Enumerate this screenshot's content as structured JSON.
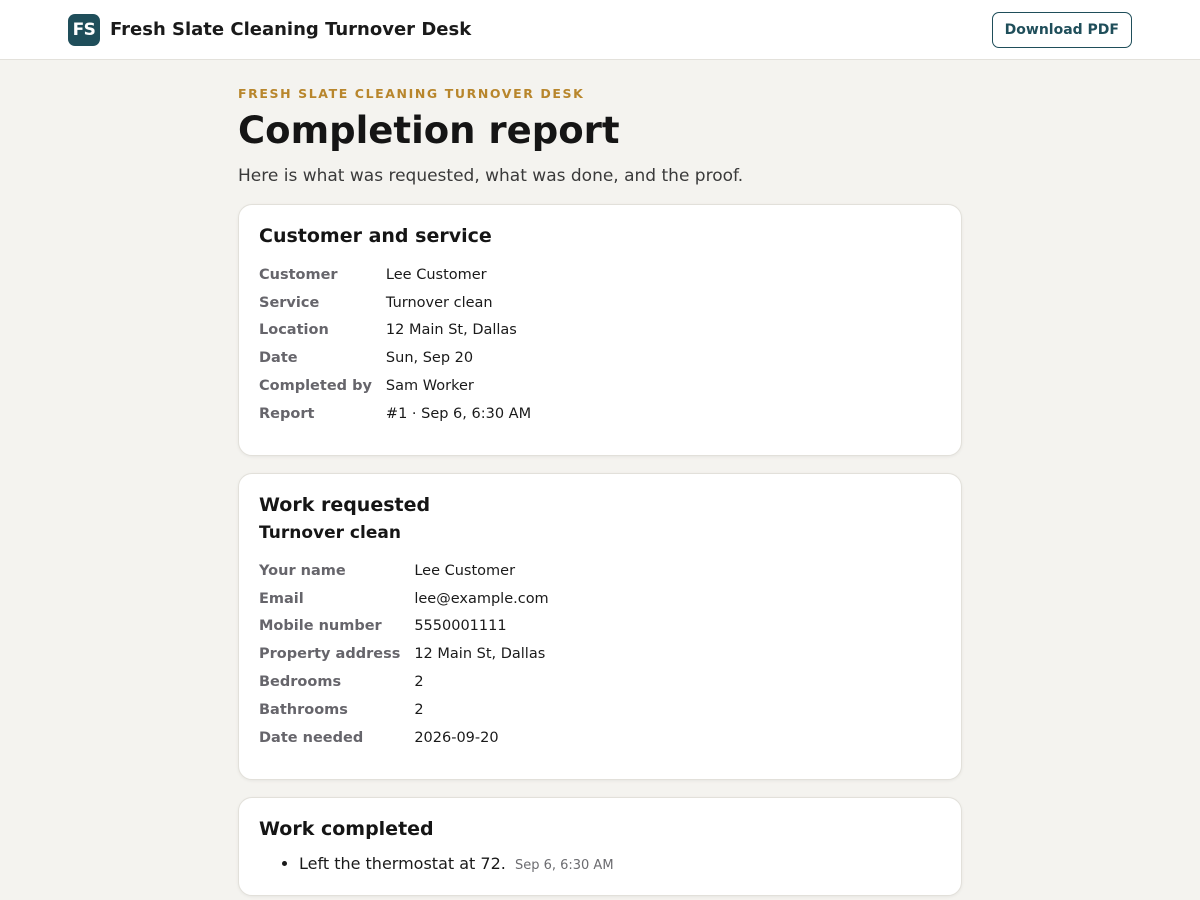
{
  "header": {
    "logo_text": "FS",
    "title": "Fresh Slate Cleaning Turnover Desk",
    "download_label": "Download PDF"
  },
  "page": {
    "eyebrow": "FRESH SLATE CLEANING TURNOVER DESK",
    "title": "Completion report",
    "subtitle": "Here is what was requested, what was done, and the proof."
  },
  "customer_service": {
    "heading": "Customer and service",
    "rows": [
      {
        "label": "Customer",
        "value": "Lee Customer"
      },
      {
        "label": "Service",
        "value": "Turnover clean"
      },
      {
        "label": "Location",
        "value": "12 Main St, Dallas"
      },
      {
        "label": "Date",
        "value": "Sun, Sep 20"
      },
      {
        "label": "Completed by",
        "value": "Sam Worker"
      },
      {
        "label": "Report",
        "value": "#1 · Sep 6, 6:30 AM"
      }
    ]
  },
  "work_requested": {
    "heading": "Work requested",
    "subheading": "Turnover clean",
    "rows": [
      {
        "label": "Your name",
        "value": "Lee Customer"
      },
      {
        "label": "Email",
        "value": "lee@example.com"
      },
      {
        "label": "Mobile number",
        "value": "5550001111"
      },
      {
        "label": "Property address",
        "value": "12 Main St, Dallas"
      },
      {
        "label": "Bedrooms",
        "value": "2"
      },
      {
        "label": "Bathrooms",
        "value": "2"
      },
      {
        "label": "Date needed",
        "value": "2026-09-20"
      }
    ]
  },
  "work_completed": {
    "heading": "Work completed",
    "items": [
      {
        "text": "Left the thermostat at 72.",
        "time": "Sep 6, 6:30 AM"
      }
    ]
  },
  "colors": {
    "brand": "#1f4e5a",
    "accent": "#b8862c",
    "background": "#f4f3ef"
  }
}
